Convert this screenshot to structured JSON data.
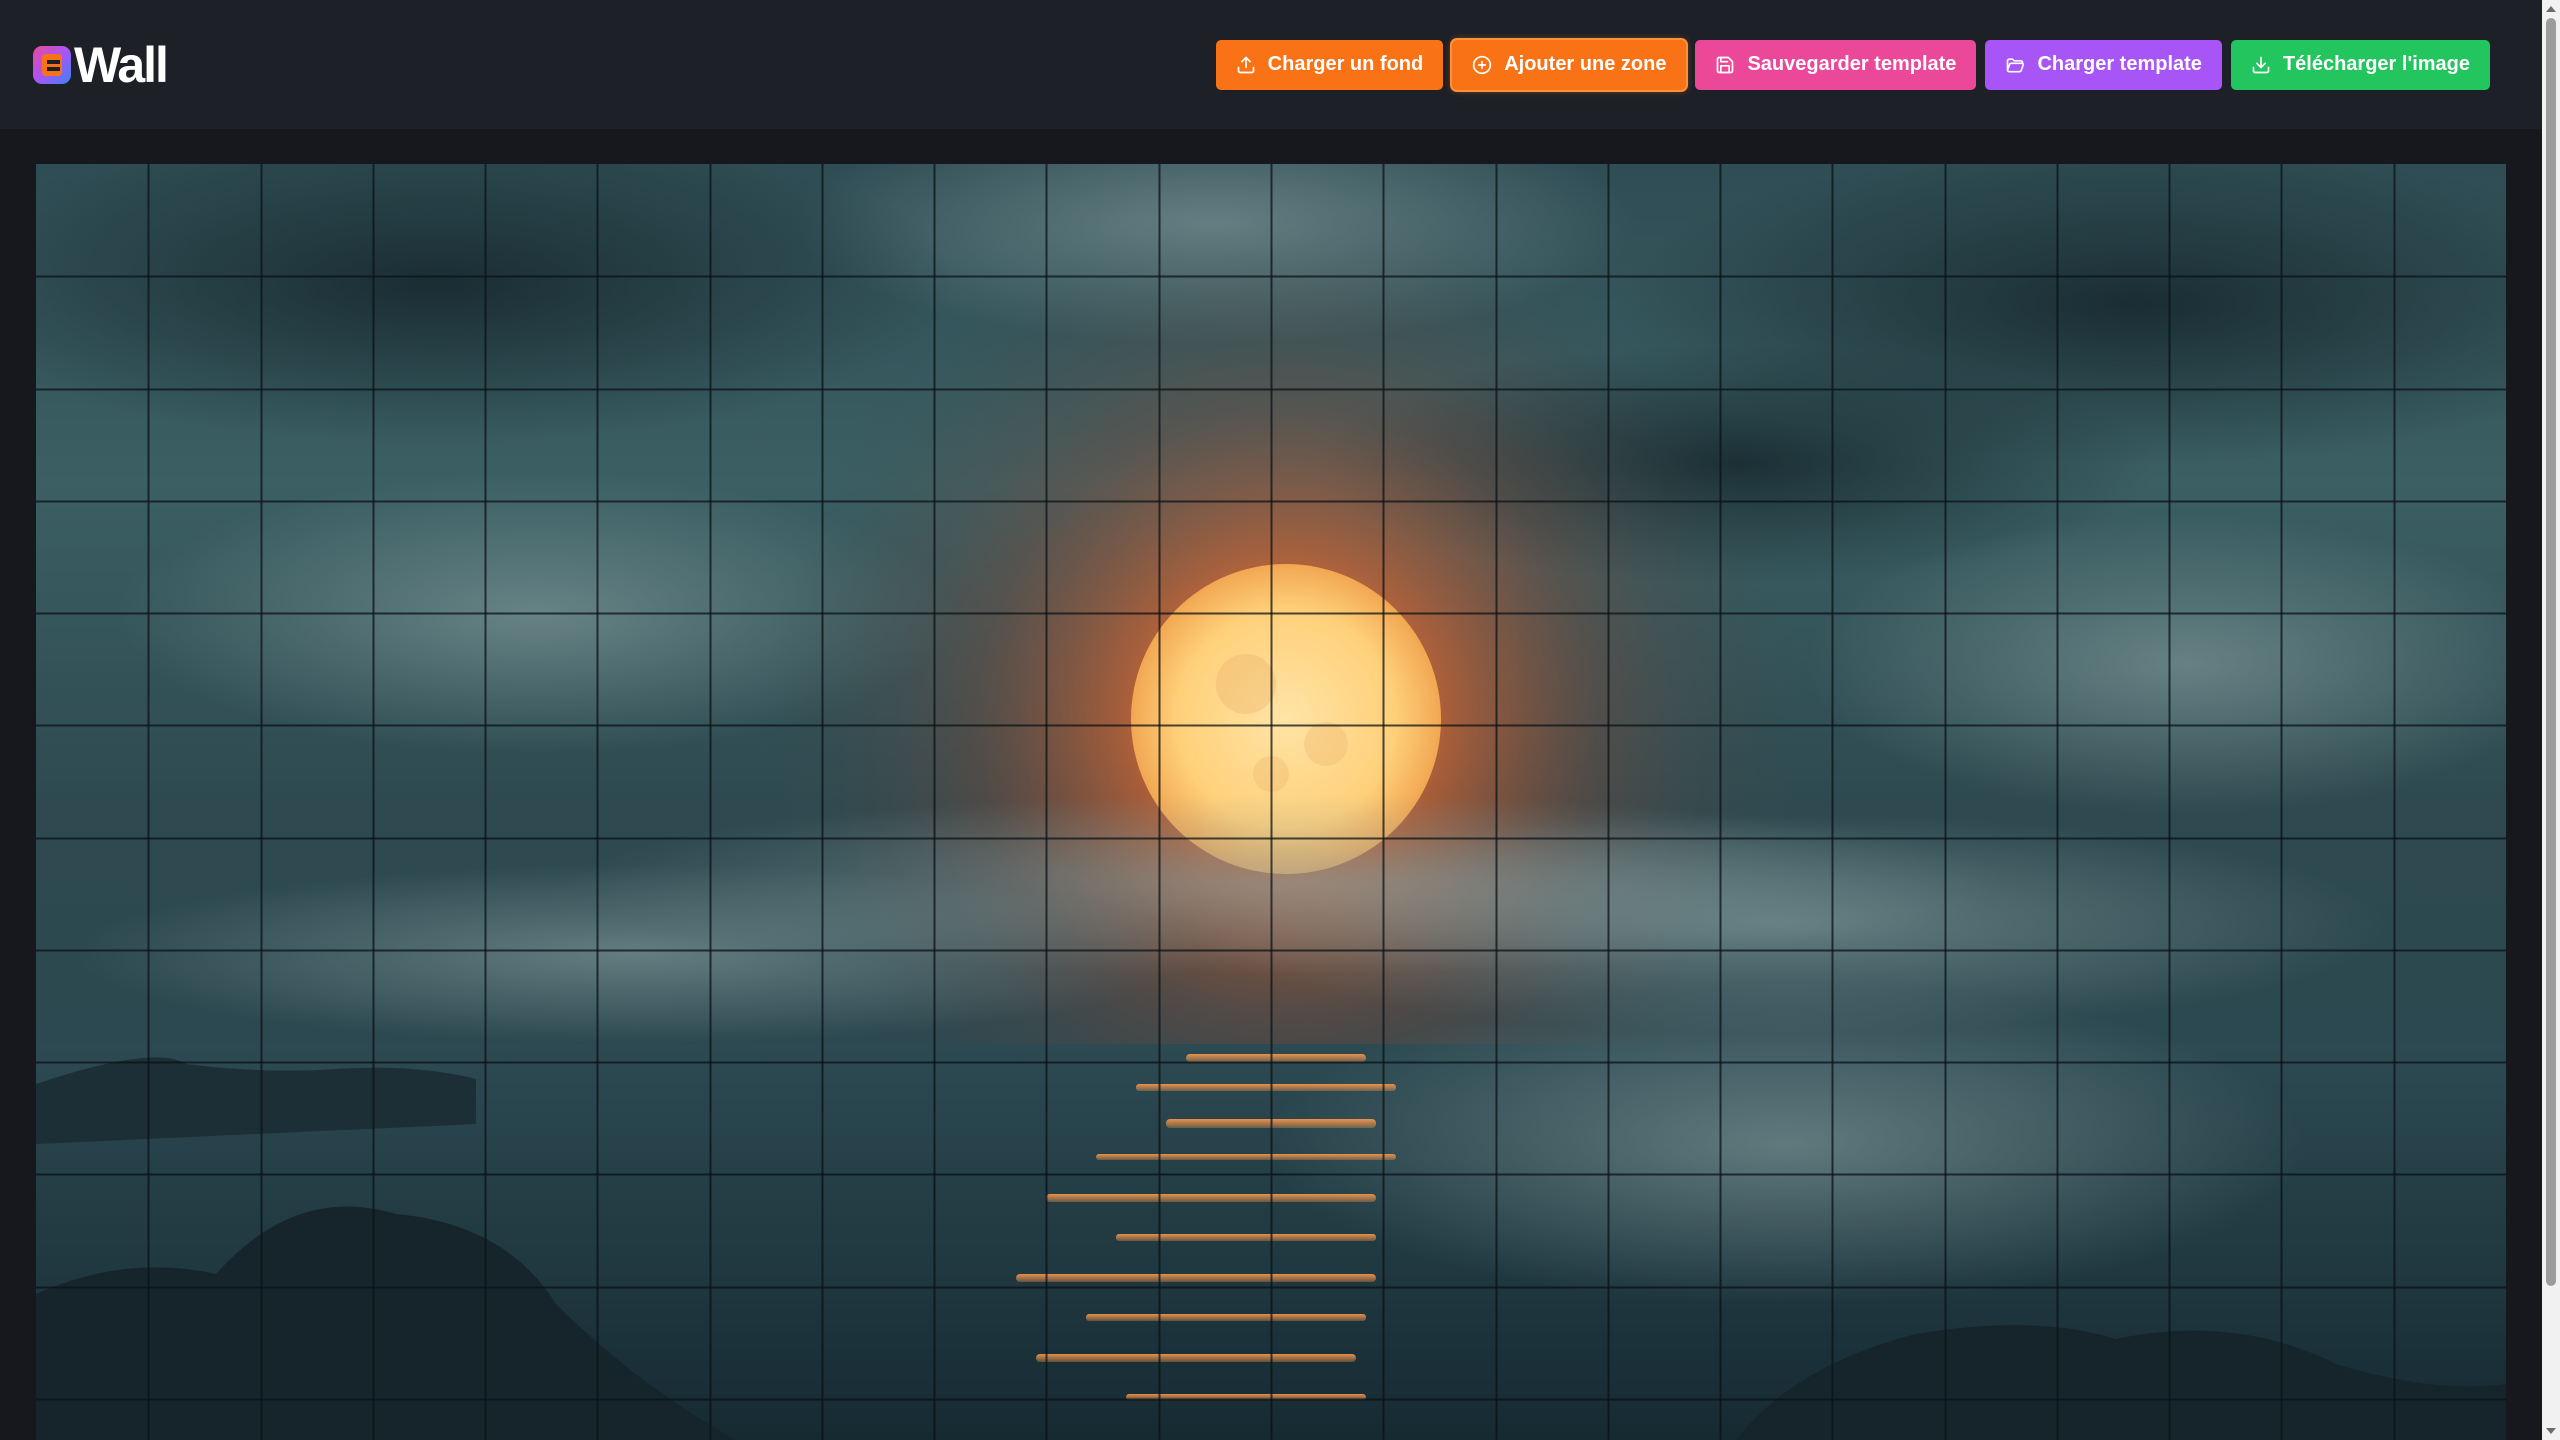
{
  "app": {
    "logo_text": "Wall",
    "logo_colors": [
      "#ec4899",
      "#a855f7",
      "#f97316",
      "#3b82f6"
    ]
  },
  "toolbar": {
    "buttons": [
      {
        "label": "Charger un fond",
        "icon": "upload-icon",
        "color": "#f97316"
      },
      {
        "label": "Ajouter une zone",
        "icon": "plus-circle-icon",
        "color": "#f97316"
      },
      {
        "label": "Sauvegarder template",
        "icon": "save-icon",
        "color": "#ec4899"
      },
      {
        "label": "Charger template",
        "icon": "folder-open-icon",
        "color": "#a855f7"
      },
      {
        "label": "Télécharger l'image",
        "icon": "download-icon",
        "color": "#22c55e"
      }
    ]
  },
  "canvas": {
    "background": "moonrise over misty sea",
    "grid": {
      "columns": 22,
      "rows_visible": 11
    }
  }
}
